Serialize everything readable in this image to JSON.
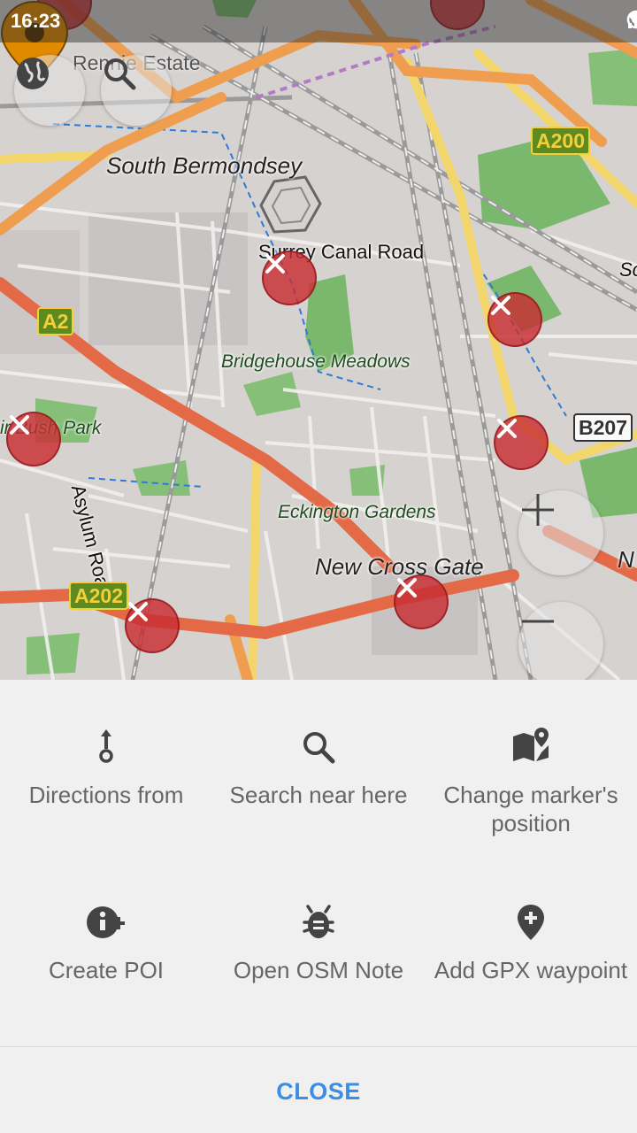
{
  "status_bar": {
    "time": "16:23"
  },
  "map": {
    "labels": {
      "rennie_estate": "Rennie Estate",
      "south_bermondsey": "South Bermondsey",
      "surrey_canal_road": "Surrey Canal Road",
      "bridgehouse_meadows": "Bridgehouse Meadows",
      "bush_park": "ir Bush Park",
      "asylum_road": "Asylum Road",
      "eckington_gardens": "Eckington Gardens",
      "new_cross_gate": "New Cross Gate",
      "partial_right_top": "Sc",
      "partial_right_mid": "N"
    },
    "shields": {
      "a200": "A200",
      "a2": "A2",
      "a202": "A202",
      "b207": "B207"
    }
  },
  "actions": [
    {
      "label": "Directions from",
      "icon": "directions-from-icon"
    },
    {
      "label": "Search near here",
      "icon": "search-icon"
    },
    {
      "label": "Change marker's position",
      "icon": "map-marker-move-icon"
    },
    {
      "label": "Create POI",
      "icon": "info-plus-icon"
    },
    {
      "label": "Open OSM Note",
      "icon": "bug-icon"
    },
    {
      "label": "Add GPX waypoint",
      "icon": "add-location-icon"
    }
  ],
  "close_label": "CLOSE",
  "colors": {
    "accent": "#3a8ee6",
    "marker": "#e08a00",
    "poi": "#c82d32"
  }
}
